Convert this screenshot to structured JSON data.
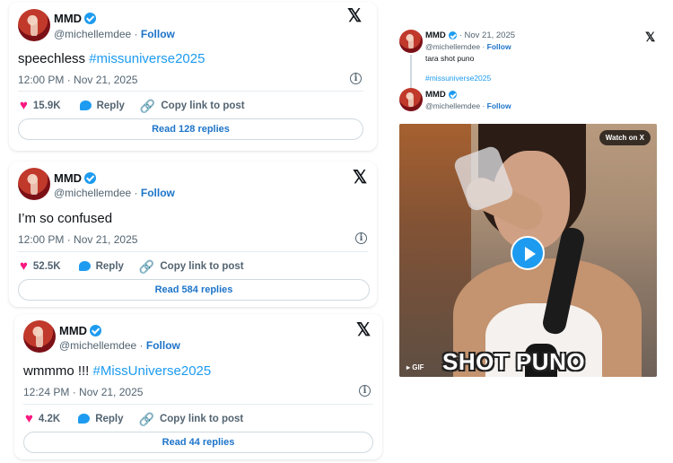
{
  "posts": [
    {
      "name": "MMD",
      "handle": "@michellemdee",
      "follow": "Follow",
      "text": "speechless ",
      "hashtag": "#missuniverse2025",
      "time": "12:00 PM · Nov 21, 2025",
      "likes": "15.9K",
      "reply": "Reply",
      "copy": "Copy link to post",
      "read": "Read 128 replies"
    },
    {
      "name": "MMD",
      "handle": "@michellemdee",
      "follow": "Follow",
      "text": "I’m so confused",
      "hashtag": "",
      "time": "12:00 PM · Nov 21, 2025",
      "likes": "52.5K",
      "reply": "Reply",
      "copy": "Copy link to post",
      "read": "Read 584 replies"
    },
    {
      "name": "MMD",
      "handle": "@michellemdee",
      "follow": "Follow",
      "text": "wmmmo !!! ",
      "hashtag": "#MissUniverse2025",
      "time": "12:24 PM · Nov 21, 2025",
      "likes": "4.2K",
      "reply": "Reply",
      "copy": "Copy link to post",
      "read": "Read 44 replies"
    }
  ],
  "embed": {
    "parent": {
      "name": "MMD",
      "date": "· Nov 21, 2025",
      "handle": "@michellemdee",
      "follow": "Follow",
      "text": "tara shot puno",
      "hashtag": "#missuniverse2025"
    },
    "child": {
      "name": "MMD",
      "handle": "@michellemdee",
      "follow": "Follow"
    },
    "watch_label": "Watch on X",
    "caption": "SHOT PUNO",
    "gif_label": "▸ GIF"
  },
  "icons": {
    "x_logo": "𝕏",
    "heart": "♥",
    "link": "🔗",
    "info": "i"
  },
  "colors": {
    "accent": "#1d9bf0",
    "like": "#f91880",
    "follow": "#1d74c9"
  }
}
